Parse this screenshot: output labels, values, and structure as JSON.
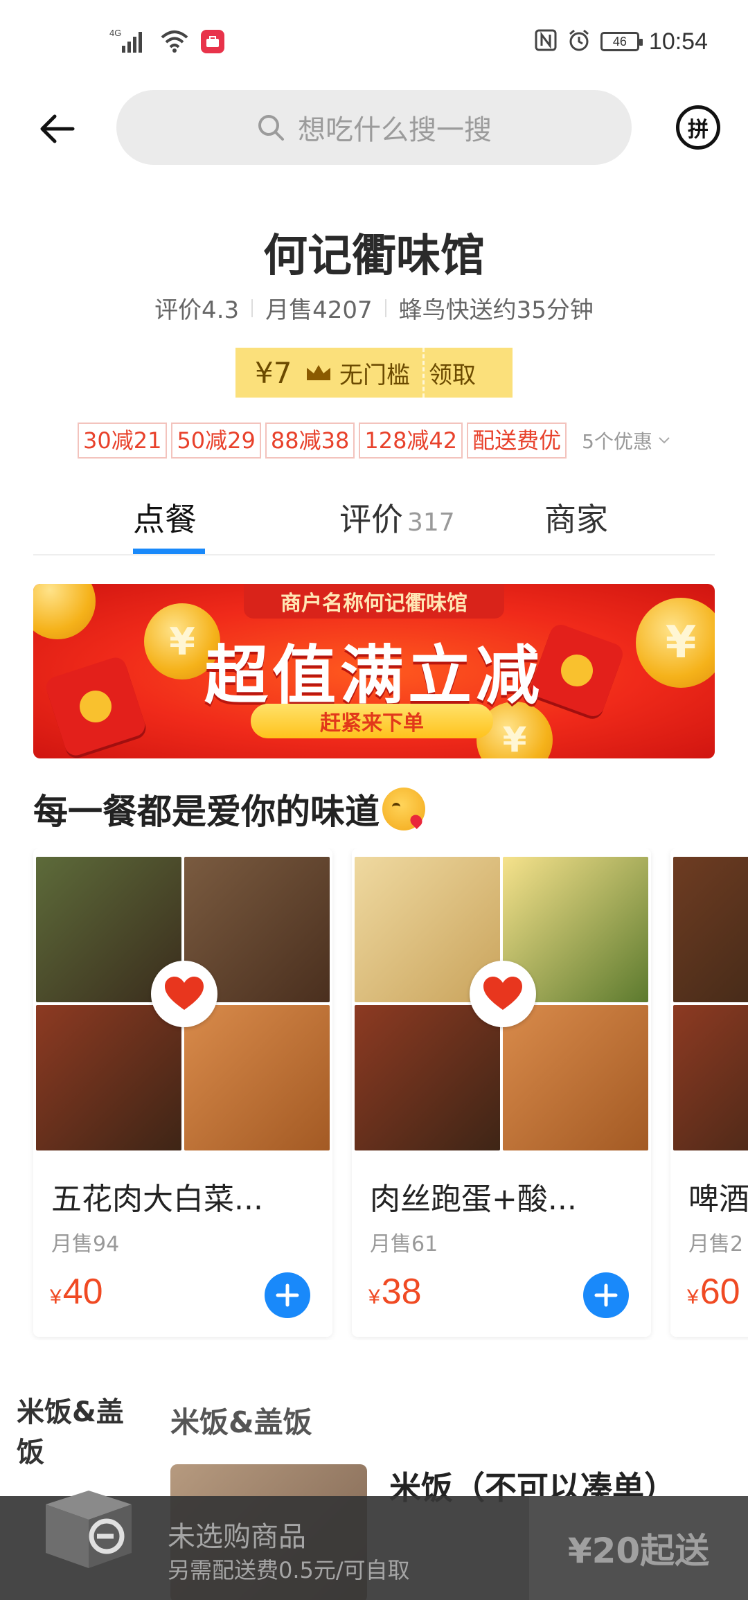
{
  "status_bar": {
    "network": "4G",
    "battery": "46",
    "time": "10:54"
  },
  "top_nav": {
    "search_placeholder": "想吃什么搜一搜",
    "group_label": "拼"
  },
  "shop": {
    "name": "何记衢味馆",
    "rating": "评价4.3",
    "monthly_sales": "月售4207",
    "delivery": "蜂鸟快送约35分钟"
  },
  "coupon": {
    "amount": "¥7",
    "condition": "无门槛",
    "action": "领取"
  },
  "promotions": {
    "tags": [
      "30减21",
      "50减29",
      "88减38",
      "128减42",
      "配送费优"
    ],
    "more": "5个优惠"
  },
  "tabs": {
    "order": "点餐",
    "reviews": "评价",
    "reviews_count": "317",
    "merchant": "商家"
  },
  "banner": {
    "top_label": "商户名称何记衢味馆",
    "title": "超值满立减",
    "button": "赶紧来下单"
  },
  "section": {
    "heading": "每一餐都是爱你的味道"
  },
  "products": [
    {
      "title": "五花肉大白菜...",
      "sales": "月售94",
      "currency": "¥",
      "price": "40",
      "image_colors": [
        "#6b5a3a",
        "#7a5b40",
        "#8d3a22",
        "#c8773b"
      ]
    },
    {
      "title": "肉丝跑蛋+酸...",
      "sales": "月售61",
      "currency": "¥",
      "price": "38",
      "image_colors": [
        "#e6c98a",
        "#f0d77a",
        "#8d3a22",
        "#c8773b"
      ]
    },
    {
      "title": "啤酒",
      "sales": "月售2",
      "currency": "¥",
      "price": "60",
      "image_colors": [
        "#7b4a2c",
        "#5d6b3a",
        "#8d3a22",
        "#c8773b"
      ]
    }
  ],
  "menu": {
    "side_category": "米饭&盖饭",
    "heading": "米饭&盖饭",
    "first_dish": "米饭（不可以凑单）"
  },
  "cart": {
    "empty": "未选购商品",
    "fee": "另需配送费0.5元/可自取",
    "minimum": "¥20起送"
  },
  "colors": {
    "accent_blue": "#1989fa",
    "price_red": "#f04a23",
    "coupon_yellow": "#fbe07b"
  }
}
